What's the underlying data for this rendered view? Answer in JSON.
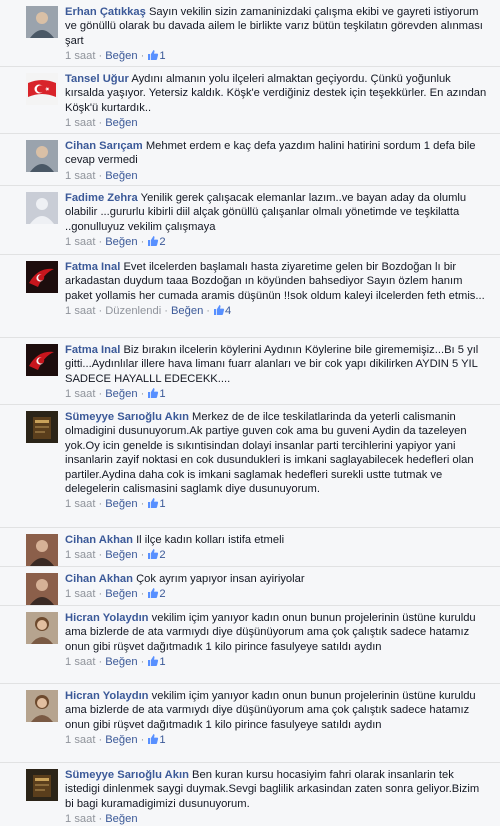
{
  "labels": {
    "like": "Beğen",
    "edited": "Düzenlendi",
    "sep": "·"
  },
  "comments": [
    {
      "author": "Erhan Çatıkkaş",
      "text": "Sayın vekilin sizin zamaninizdaki çalışma ekibi ve gayreti istiyorum ve gönüllü olarak bu davada ailem le birlikte varız bütün teşkilatın görevden alınması şart",
      "time": "1 saat",
      "likes": "1",
      "avatar": "avatar-photo-man"
    },
    {
      "author": "Tansel Uğur",
      "text": "Aydını almanın yolu ilçeleri almaktan geçiyordu. Çünkü yoğunluk kırsalda yaşıyor. Yetersiz kaldık. Köşk'e verdiğiniz destek için teşekkürler. En azından Köşk'ü kurtardık..",
      "time": "1 saat",
      "likes": "",
      "avatar": "avatar-turkish-flag"
    },
    {
      "author": "Cihan Sarıçam",
      "text": "Mehmet erdem e kaç defa yazdım halini hatirini sordum 1 defa bile cevap vermedi",
      "time": "1 saat",
      "likes": "",
      "avatar": "avatar-photo-man"
    },
    {
      "author": "Fadime Zehra",
      "text": "Yenilik gerek çalışacak elemanlar lazım..ve bayan aday da olumlu olabilir ...gururlu kibirli diil alçak gönüllü çalışanlar olmalı yönetimde ve teşkilatta ..gonulluyuz vekilim çalışmaya",
      "time": "1 saat",
      "likes": "2",
      "avatar": "avatar-default"
    },
    {
      "author": "Fatma Inal",
      "text": "Evet ilcelerden başlamalı hasta ziyaretime gelen bir Bozdoğan lı bir arkadastan duydum taaa Bozdoğan ın köyünden bahsediyor Sayın özlem hanım paket yollamis her cumada aramis düşünün !!sok oldum kaleyi ilcelerden feth etmis...",
      "time": "1 saat",
      "edited": true,
      "likes": "4",
      "avatar": "avatar-flag-dark"
    },
    {
      "author": "Fatma Inal",
      "text": "Biz bırakın ilcelerin köylerini Aydının Köylerine bile girememişiz...Bı 5 yıl gitti...Aydınlılar illere hava limanı fuarr alanları ve bir cok yapı dikilirken AYDIN 5 YIL SADECE HAYALLL EDECEKK....",
      "time": "1 saat",
      "likes": "1",
      "avatar": "avatar-flag-dark"
    },
    {
      "author": "Sümeyye Sarıoğlu Akın",
      "text": "Merkez de de ilce teskilatlarinda da yeterli calismanin olmadigini dusunuyorum.Ak partiye guven cok ama bu guveni Aydin da tazeleyen yok.Oy icin genelde is sıkıntisindan dolayi insanlar parti tercihlerini yapiyor yani insanlarin zayif noktasi en cok dusundukleri is imkani saglayabilecek hedefleri olan partiler.Aydina daha cok is imkani saglamak hedefleri surekli ustte tutmak ve delegelerin calismasini saglamk diye dusunuyorum.",
      "time": "1 saat",
      "likes": "1",
      "avatar": "avatar-book-dark"
    },
    {
      "author": "Cihan Akhan",
      "text": "Il ilçe kadın kolları istifa etmeli",
      "time": "1 saat",
      "likes": "2",
      "avatar": "avatar-photo-man2"
    },
    {
      "author": "Cihan Akhan",
      "text": "Çok ayrım yapıyor insan ayiriyolar",
      "time": "1 saat",
      "likes": "2",
      "avatar": "avatar-photo-man2"
    },
    {
      "author": "Hicran Yolaydın",
      "text": "vekilim içim yanıyor kadın onun bunun projelerinin üstüne kuruldu ama bizlerde de ata varmıydı diye düşünüyorum ama çok çalıştık sadece hatamız onun gibi rüşvet dağıtmadık 1 kilo pirince fasulyeye satıldı aydın",
      "time": "1 saat",
      "likes": "1",
      "avatar": "avatar-photo-woman"
    },
    {
      "author": "Hicran Yolaydın",
      "text": "vekilim içim yanıyor kadın onun bunun projelerinin üstüne kuruldu ama bizlerde de ata varmıydı diye düşünüyorum ama çok çalıştık sadece hatamız onun gibi rüşvet dağıtmadık 1 kilo pirince fasulyeye satıldı aydın",
      "time": "1 saat",
      "likes": "1",
      "avatar": "avatar-photo-woman"
    },
    {
      "author": "Sümeyye Sarıoğlu Akın",
      "text": "Ben kuran kursu hocasiyim fahri olarak insanlarin tek istedigi dinlenmek saygi duymak.Sevgi baglilik arkasindan zaten sonra geliyor.Bizim bi bagi kuramadigimizi dusunuyorum.",
      "time": "1 saat",
      "likes": "",
      "avatar": "avatar-book-dark"
    }
  ]
}
